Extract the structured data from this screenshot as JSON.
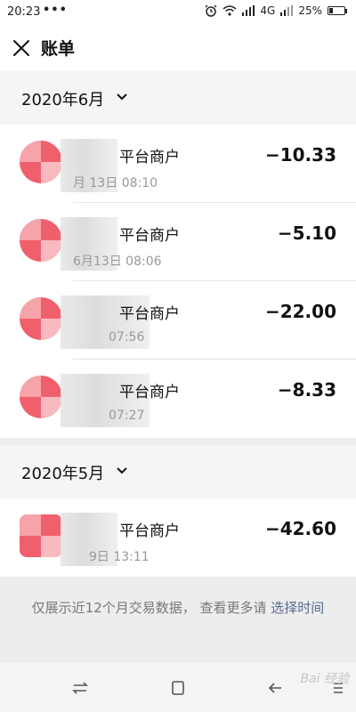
{
  "status_bar": {
    "time": "20:23",
    "dots": "•••",
    "network": "4G",
    "battery_percent": "25%"
  },
  "app_bar": {
    "title": "账单",
    "close_icon": "close-icon"
  },
  "months": [
    {
      "label": "2020年6月",
      "transactions": [
        {
          "name": "平台商户",
          "time": "月 13日 08:10",
          "amount": "−10.33"
        },
        {
          "name": "平台商户",
          "time": "6月13日 08:06",
          "amount": "−5.10"
        },
        {
          "name": "平台商户",
          "time": "07:56",
          "amount": "−22.00"
        },
        {
          "name": "平台商户",
          "time": "07:27",
          "amount": "−8.33"
        }
      ]
    },
    {
      "label": "2020年5月",
      "transactions": [
        {
          "name": "平台商户",
          "time": "9日 13:11",
          "amount": "−42.60"
        }
      ]
    }
  ],
  "footer": {
    "note": "仅展示近12个月交易数据， 查看更多请 ",
    "link": "选择时间"
  },
  "watermark": "Bai 经验",
  "colors": {
    "link": "#576b95",
    "avatar": "#f0606c",
    "section_bg": "#f5f5f5"
  }
}
